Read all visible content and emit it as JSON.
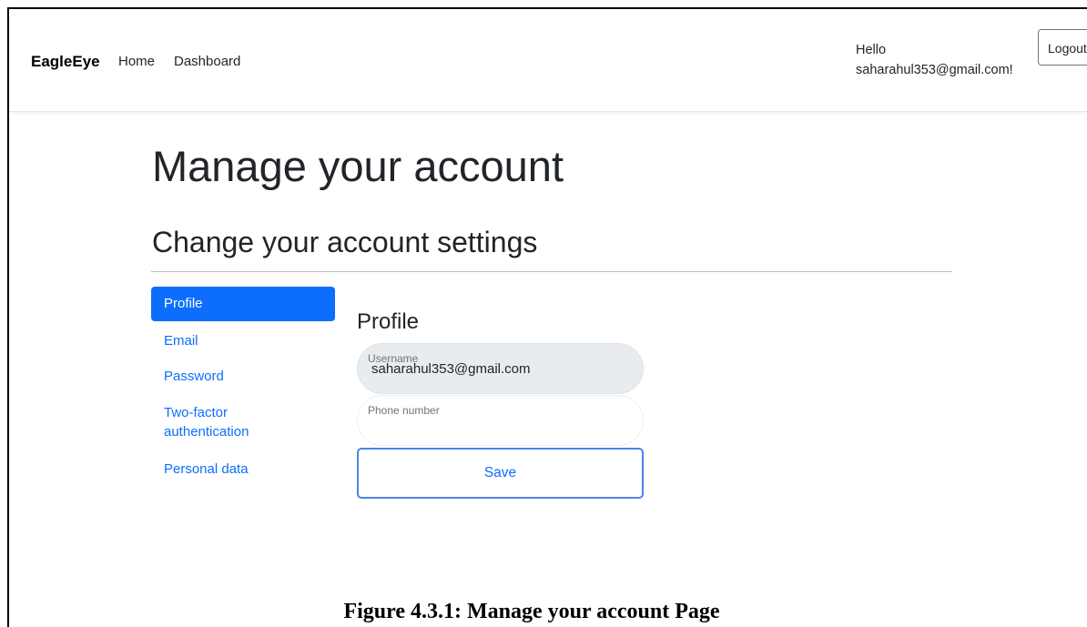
{
  "navbar": {
    "brand": "EagleEye",
    "links": [
      "Home",
      "Dashboard"
    ],
    "greeting_line1": "Hello",
    "greeting_line2": "saharahul353@gmail.com!",
    "logout_label": "Logout"
  },
  "page": {
    "title": "Manage your account",
    "subtitle": "Change your account settings"
  },
  "sidebar": {
    "items": [
      {
        "label": "Profile",
        "active": true
      },
      {
        "label": "Email",
        "active": false
      },
      {
        "label": "Password",
        "active": false
      },
      {
        "label": "Two-factor authentication",
        "active": false
      },
      {
        "label": "Personal data",
        "active": false
      }
    ]
  },
  "profile_form": {
    "heading": "Profile",
    "username_label": "Username",
    "username_value": "saharahul353@gmail.com",
    "phone_label": "Phone number",
    "phone_value": "",
    "save_label": "Save"
  },
  "caption": "Figure 4.3.1: Manage your account Page",
  "colors": {
    "primary": "#0d6efd",
    "readonly_field_bg": "#e9ecef",
    "save_border": "#4a86e8"
  }
}
